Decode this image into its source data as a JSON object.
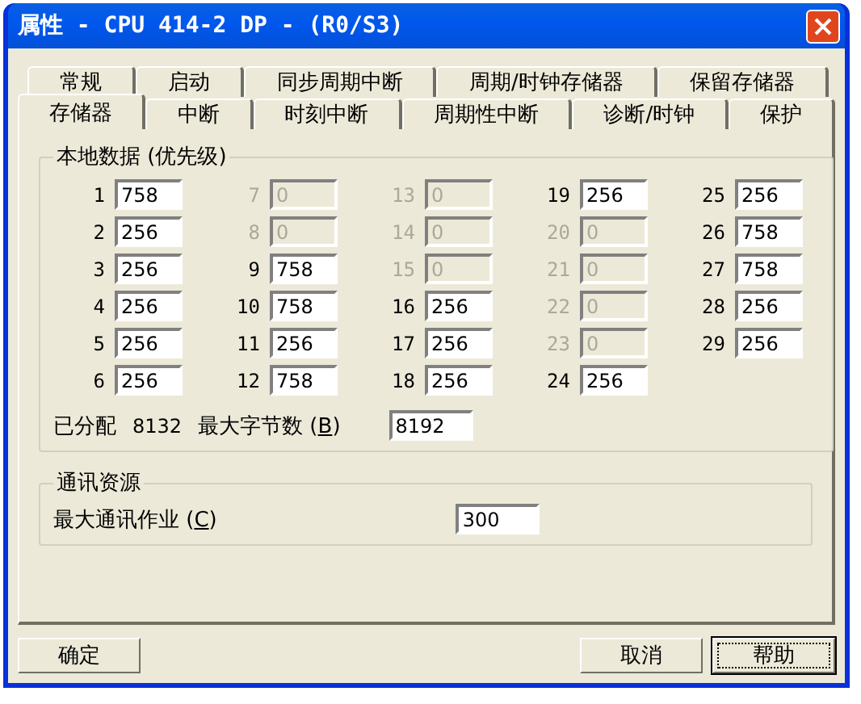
{
  "window": {
    "title": "属性 - CPU 414-2 DP - (R0/S3)"
  },
  "tab_rows": [
    {
      "tabs": [
        {
          "label": "常规",
          "selected": false
        },
        {
          "label": "启动",
          "selected": false
        },
        {
          "label": "同步周期中断",
          "selected": false
        },
        {
          "label": "周期/时钟存储器",
          "selected": false
        },
        {
          "label": "保留存储器",
          "selected": false
        }
      ]
    },
    {
      "tabs": [
        {
          "label": "存储器",
          "selected": true
        },
        {
          "label": "中断",
          "selected": false
        },
        {
          "label": "时刻中断",
          "selected": false
        },
        {
          "label": "周期性中断",
          "selected": false
        },
        {
          "label": "诊断/时钟",
          "selected": false
        },
        {
          "label": "保护",
          "selected": false
        }
      ]
    }
  ],
  "local_data": {
    "title": "本地数据 (优先级)",
    "columns": [
      [
        {
          "number": "1",
          "value": "758",
          "disabled": false
        },
        {
          "number": "2",
          "value": "256",
          "disabled": false
        },
        {
          "number": "3",
          "value": "256",
          "disabled": false
        },
        {
          "number": "4",
          "value": "256",
          "disabled": false
        },
        {
          "number": "5",
          "value": "256",
          "disabled": false
        },
        {
          "number": "6",
          "value": "256",
          "disabled": false
        }
      ],
      [
        {
          "number": "7",
          "value": "0",
          "disabled": true
        },
        {
          "number": "8",
          "value": "0",
          "disabled": true
        },
        {
          "number": "9",
          "value": "758",
          "disabled": false
        },
        {
          "number": "10",
          "value": "758",
          "disabled": false
        },
        {
          "number": "11",
          "value": "256",
          "disabled": false
        },
        {
          "number": "12",
          "value": "758",
          "disabled": false
        }
      ],
      [
        {
          "number": "13",
          "value": "0",
          "disabled": true
        },
        {
          "number": "14",
          "value": "0",
          "disabled": true
        },
        {
          "number": "15",
          "value": "0",
          "disabled": true
        },
        {
          "number": "16",
          "value": "256",
          "disabled": false
        },
        {
          "number": "17",
          "value": "256",
          "disabled": false
        },
        {
          "number": "18",
          "value": "256",
          "disabled": false
        }
      ],
      [
        {
          "number": "19",
          "value": "256",
          "disabled": false
        },
        {
          "number": "20",
          "value": "0",
          "disabled": true
        },
        {
          "number": "21",
          "value": "0",
          "disabled": true
        },
        {
          "number": "22",
          "value": "0",
          "disabled": true
        },
        {
          "number": "23",
          "value": "0",
          "disabled": true
        },
        {
          "number": "24",
          "value": "256",
          "disabled": false
        }
      ],
      [
        {
          "number": "25",
          "value": "256",
          "disabled": false
        },
        {
          "number": "26",
          "value": "758",
          "disabled": false
        },
        {
          "number": "27",
          "value": "758",
          "disabled": false
        },
        {
          "number": "28",
          "value": "256",
          "disabled": false
        },
        {
          "number": "29",
          "value": "256",
          "disabled": false
        }
      ]
    ],
    "allocated_label": "已分配",
    "allocated_value": "8132",
    "max_bytes": {
      "label_before": "最大字节数 (",
      "mnemonic": "B",
      "label_after": ")",
      "value": "8192"
    }
  },
  "comm_resources": {
    "title": "通讯资源",
    "max_jobs": {
      "label_before": "最大通讯作业 (",
      "mnemonic": "C",
      "label_after": ")",
      "value": "300"
    }
  },
  "buttons": [
    {
      "label": "确定",
      "focused": false
    },
    {
      "label": "取消",
      "focused": false
    },
    {
      "label": "帮助",
      "focused": true
    }
  ]
}
